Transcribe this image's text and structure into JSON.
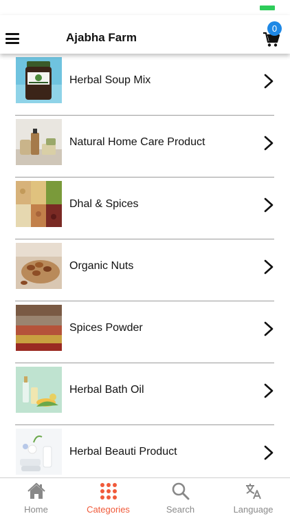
{
  "header": {
    "title": "Ajabha Farm",
    "cart_count": "0",
    "menu_icon": "hamburger-menu-icon",
    "cart_icon": "shopping-cart-icon"
  },
  "categories": [
    {
      "label": "Herbal Soup Mix",
      "thumb": "herbal-soup-jar-image"
    },
    {
      "label": "Natural Home Care Product",
      "thumb": "home-care-bottles-image"
    },
    {
      "label": "Dhal & Spices",
      "thumb": "dhal-beans-image"
    },
    {
      "label": "Organic Nuts",
      "thumb": "almonds-bowl-image"
    },
    {
      "label": "Spices Powder",
      "thumb": "spice-powder-image"
    },
    {
      "label": "Herbal Bath Oil",
      "thumb": "bath-oil-bottles-image"
    },
    {
      "label": "Herbal Beauti Product",
      "thumb": "beauty-spa-image"
    }
  ],
  "tabbar": {
    "home": "Home",
    "categories": "Categories",
    "search": "Search",
    "language": "Language",
    "active": "Categories",
    "active_color": "#f05a3a",
    "inactive_color": "#8a8a8a"
  },
  "colors": {
    "badge": "#1e88e5",
    "battery": "#2ecc5a"
  }
}
